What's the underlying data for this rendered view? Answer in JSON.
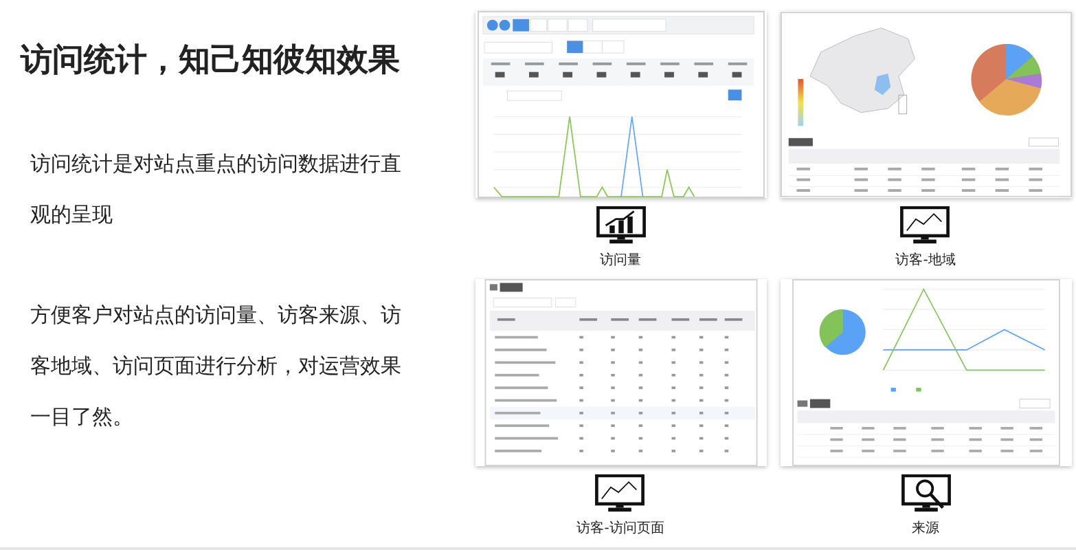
{
  "title": "访问统计，知己知彼知效果",
  "paragraphs": [
    "访问统计是对站点重点的访问数据进行直观的呈现",
    "方便客户对站点的访问量、访客来源、访客地域、访问页面进行分析，对运营效果一目了然。"
  ],
  "features": [
    {
      "kind": "traffic",
      "caption": "访问量"
    },
    {
      "kind": "region",
      "caption": "访客-地域"
    },
    {
      "kind": "pages",
      "caption": "访客-访问页面"
    },
    {
      "kind": "source",
      "caption": "来源"
    }
  ]
}
